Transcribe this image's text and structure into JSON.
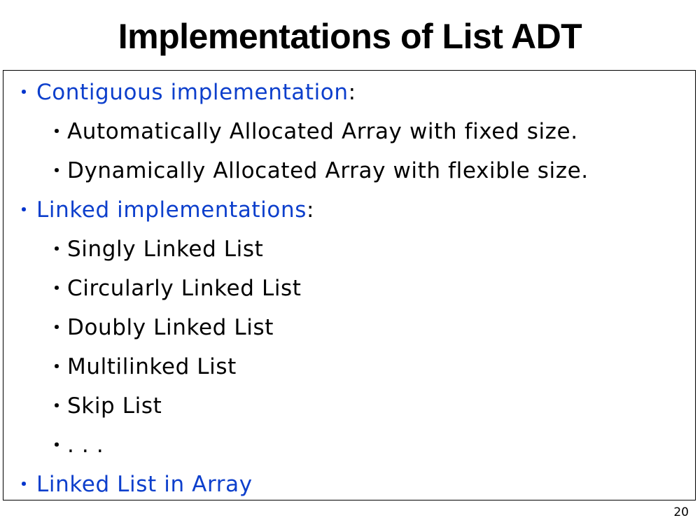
{
  "slide": {
    "title": "Implementations of List ADT",
    "page_number": "20",
    "bullet_glyph": "・",
    "colors": {
      "accent": "#0d3fcc",
      "text": "#000000",
      "border": "#000000",
      "background": "#ffffff"
    },
    "bullets": [
      {
        "label": "Contiguous implementation",
        "suffix": ":"
      },
      {
        "label": "Automatically Allocated Array with fixed size."
      },
      {
        "label": "Dynamically Allocated Array with flexible size."
      },
      {
        "label": "Linked implementations",
        "suffix": ":"
      },
      {
        "label": "Singly Linked List"
      },
      {
        "label": "Circularly Linked List"
      },
      {
        "label": "Doubly Linked List"
      },
      {
        "label": "Multilinked List"
      },
      {
        "label": "Skip List"
      },
      {
        "label": ". . ."
      },
      {
        "label": "Linked List in Array"
      }
    ]
  }
}
